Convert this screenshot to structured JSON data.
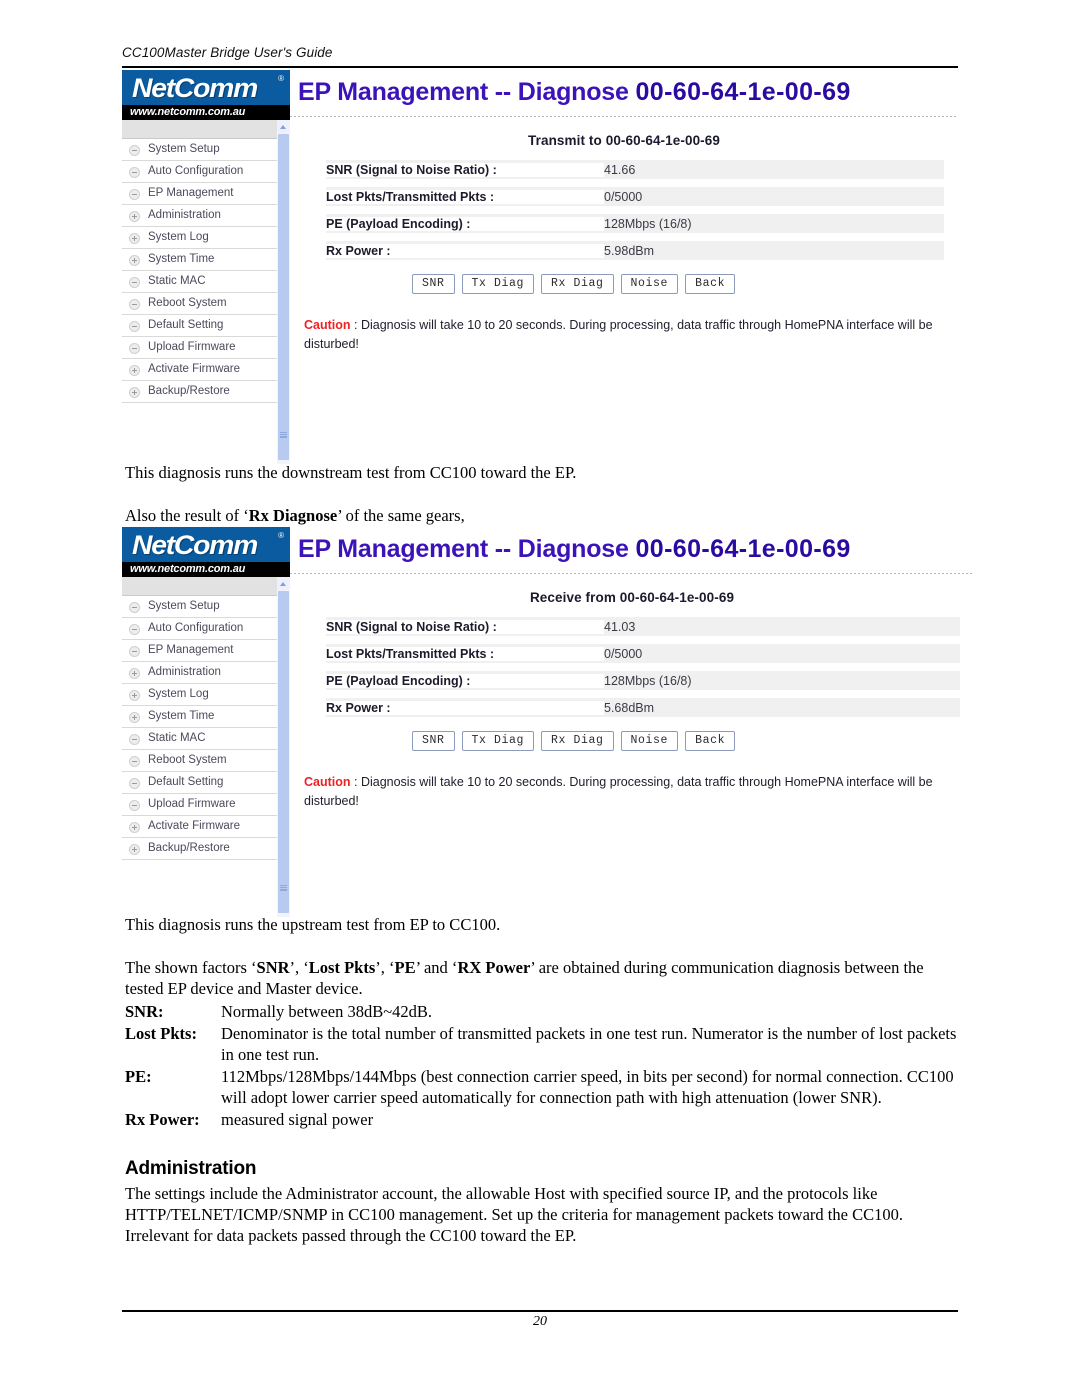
{
  "document": {
    "running_head": "CC100Master Bridge User's Guide",
    "page_number": "20"
  },
  "logo": {
    "wordmark": "NetComm",
    "registered": "®",
    "url": "www.netcomm.com.au"
  },
  "menu_items": [
    {
      "label": "System Setup",
      "state": "minus"
    },
    {
      "label": "Auto Configuration",
      "state": "minus"
    },
    {
      "label": "EP Management",
      "state": "minus"
    },
    {
      "label": "Administration",
      "state": "plus"
    },
    {
      "label": "System Log",
      "state": "plus"
    },
    {
      "label": "System Time",
      "state": "plus"
    },
    {
      "label": "Static MAC",
      "state": "minus"
    },
    {
      "label": "Reboot System",
      "state": "minus"
    },
    {
      "label": "Default Setting",
      "state": "minus"
    },
    {
      "label": "Upload Firmware",
      "state": "minus"
    },
    {
      "label": "Activate Firmware",
      "state": "plus"
    },
    {
      "label": "Backup/Restore",
      "state": "plus"
    }
  ],
  "buttons": [
    "SNR",
    "Tx Diag",
    "Rx Diag",
    "Noise",
    "Back"
  ],
  "caution": {
    "word": "Caution",
    "text": " : Diagnosis will take 10 to 20 seconds. During processing, data traffic through HomePNA interface will be disturbed!"
  },
  "screenshot_tx": {
    "title_main": "EP Management -- Diagnose ",
    "title_mac": "00-60-64-1e-00-69",
    "subtitle": "Transmit to 00-60-64-1e-00-69",
    "fields": [
      {
        "label": "SNR (Signal to Noise Ratio) :",
        "value": "41.66"
      },
      {
        "label": "Lost Pkts/Transmitted Pkts :",
        "value": "0/5000"
      },
      {
        "label": "PE (Payload Encoding) :",
        "value": "128Mbps (16/8)"
      },
      {
        "label": "Rx Power :",
        "value": "5.98dBm"
      }
    ]
  },
  "screenshot_rx": {
    "title_main": "EP Management -- Diagnose ",
    "title_mac": "00-60-64-1e-00-69",
    "subtitle": "Receive from 00-60-64-1e-00-69",
    "fields": [
      {
        "label": "SNR (Signal to Noise Ratio) :",
        "value": "41.03"
      },
      {
        "label": "Lost Pkts/Transmitted Pkts :",
        "value": "0/5000"
      },
      {
        "label": "PE (Payload Encoding) :",
        "value": "128Mbps (16/8)"
      },
      {
        "label": "Rx Power :",
        "value": "5.68dBm"
      }
    ]
  },
  "prose": {
    "after_tx": "This diagnosis runs the downstream test from CC100 toward the EP.",
    "also_result_pre": "Also the result of ‘",
    "also_result_bold": "Rx Diagnose",
    "also_result_post": "’ of the same gears,",
    "after_rx": "This diagnosis runs the upstream test from EP to CC100.",
    "factors_line1_a": "The shown factors ‘",
    "factors_b1": "SNR",
    "factors_line1_b": "’, ‘",
    "factors_b2": "Lost Pkts",
    "factors_line1_c": "’, ‘",
    "factors_b3": "PE",
    "factors_line1_d": "’ and ‘",
    "factors_b4": "RX Power",
    "factors_line1_e": "’ are obtained during communication diagnosis",
    "factors_line2": "between the tested EP device and Master device."
  },
  "definitions": [
    {
      "term": "SNR:",
      "body": "Normally between 38dB~42dB."
    },
    {
      "term": "Lost Pkts:",
      "body": "Denominator is the total number of transmitted packets in one test run. Numerator is the number of lost packets in one test run."
    },
    {
      "term": "PE:",
      "body": "112Mbps/128Mbps/144Mbps (best connection carrier speed, in bits per second) for normal connection. CC100 will adopt lower carrier speed automatically for connection path with high attenuation (lower SNR)."
    },
    {
      "term": "Rx Power:",
      "body": "measured signal power"
    }
  ],
  "administration": {
    "heading": "Administration",
    "paragraph": "The settings include the Administrator account, the allowable Host with specified source IP, and the protocols like HTTP/TELNET/ICMP/SNMP in CC100 management. Set up the criteria for management packets toward the CC100. Irrelevant for data packets passed through the CC100 toward the EP."
  },
  "colors": {
    "logo_blue": "#0a5ba0",
    "title_purple": "#3b13b8",
    "caution_red": "#ee2222",
    "scrollbar_blue": "#b9caf0"
  }
}
